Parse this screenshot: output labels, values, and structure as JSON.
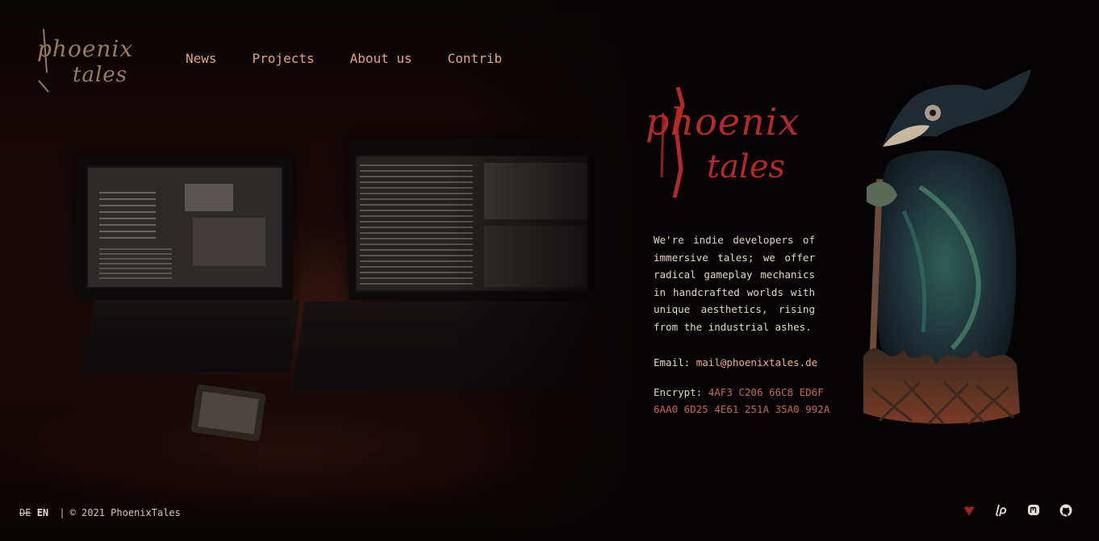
{
  "brand": {
    "logo_line1": "phoenix",
    "logo_line2": "tales",
    "hero_line1": "phoenix",
    "hero_line2": "tales",
    "accent_color": "#e3a47a",
    "hero_color": "#b52a26"
  },
  "nav": {
    "items": [
      {
        "label": "News"
      },
      {
        "label": "Projects"
      },
      {
        "label": "About us"
      },
      {
        "label": "Contrib"
      }
    ]
  },
  "intro": {
    "text": "We're indie developers of immersive tales; we offer radical gameplay mechanics in handcrafted worlds with unique aesthetics, rising from the industrial ashes."
  },
  "contact": {
    "email_label": "Email:",
    "email": "mail@phoenixtales.de",
    "encrypt_label": "Encrypt:",
    "encrypt_key_1": "4AF3 C206 66C8 ED6F",
    "encrypt_key_2": "6AA0 6D25 4E61 251A 35A0 992A"
  },
  "footer": {
    "lang_de": "DE",
    "lang_en": "EN",
    "separator": "|",
    "copyright": "© 2021 PhoenixTales"
  },
  "socials": [
    {
      "icon": "phoenix-mark-icon"
    },
    {
      "icon": "liberapay-icon"
    },
    {
      "icon": "mastodon-icon"
    },
    {
      "icon": "github-icon"
    }
  ]
}
